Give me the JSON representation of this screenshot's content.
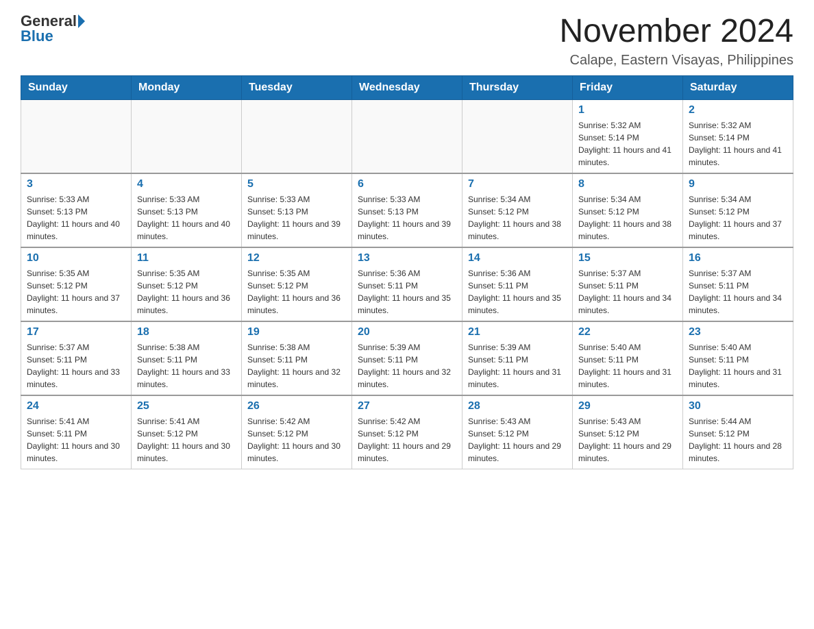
{
  "header": {
    "logo_general": "General",
    "logo_blue": "Blue",
    "month_title": "November 2024",
    "location": "Calape, Eastern Visayas, Philippines"
  },
  "days_of_week": [
    "Sunday",
    "Monday",
    "Tuesday",
    "Wednesday",
    "Thursday",
    "Friday",
    "Saturday"
  ],
  "weeks": [
    [
      {
        "day": "",
        "info": ""
      },
      {
        "day": "",
        "info": ""
      },
      {
        "day": "",
        "info": ""
      },
      {
        "day": "",
        "info": ""
      },
      {
        "day": "",
        "info": ""
      },
      {
        "day": "1",
        "info": "Sunrise: 5:32 AM\nSunset: 5:14 PM\nDaylight: 11 hours and 41 minutes."
      },
      {
        "day": "2",
        "info": "Sunrise: 5:32 AM\nSunset: 5:14 PM\nDaylight: 11 hours and 41 minutes."
      }
    ],
    [
      {
        "day": "3",
        "info": "Sunrise: 5:33 AM\nSunset: 5:13 PM\nDaylight: 11 hours and 40 minutes."
      },
      {
        "day": "4",
        "info": "Sunrise: 5:33 AM\nSunset: 5:13 PM\nDaylight: 11 hours and 40 minutes."
      },
      {
        "day": "5",
        "info": "Sunrise: 5:33 AM\nSunset: 5:13 PM\nDaylight: 11 hours and 39 minutes."
      },
      {
        "day": "6",
        "info": "Sunrise: 5:33 AM\nSunset: 5:13 PM\nDaylight: 11 hours and 39 minutes."
      },
      {
        "day": "7",
        "info": "Sunrise: 5:34 AM\nSunset: 5:12 PM\nDaylight: 11 hours and 38 minutes."
      },
      {
        "day": "8",
        "info": "Sunrise: 5:34 AM\nSunset: 5:12 PM\nDaylight: 11 hours and 38 minutes."
      },
      {
        "day": "9",
        "info": "Sunrise: 5:34 AM\nSunset: 5:12 PM\nDaylight: 11 hours and 37 minutes."
      }
    ],
    [
      {
        "day": "10",
        "info": "Sunrise: 5:35 AM\nSunset: 5:12 PM\nDaylight: 11 hours and 37 minutes."
      },
      {
        "day": "11",
        "info": "Sunrise: 5:35 AM\nSunset: 5:12 PM\nDaylight: 11 hours and 36 minutes."
      },
      {
        "day": "12",
        "info": "Sunrise: 5:35 AM\nSunset: 5:12 PM\nDaylight: 11 hours and 36 minutes."
      },
      {
        "day": "13",
        "info": "Sunrise: 5:36 AM\nSunset: 5:11 PM\nDaylight: 11 hours and 35 minutes."
      },
      {
        "day": "14",
        "info": "Sunrise: 5:36 AM\nSunset: 5:11 PM\nDaylight: 11 hours and 35 minutes."
      },
      {
        "day": "15",
        "info": "Sunrise: 5:37 AM\nSunset: 5:11 PM\nDaylight: 11 hours and 34 minutes."
      },
      {
        "day": "16",
        "info": "Sunrise: 5:37 AM\nSunset: 5:11 PM\nDaylight: 11 hours and 34 minutes."
      }
    ],
    [
      {
        "day": "17",
        "info": "Sunrise: 5:37 AM\nSunset: 5:11 PM\nDaylight: 11 hours and 33 minutes."
      },
      {
        "day": "18",
        "info": "Sunrise: 5:38 AM\nSunset: 5:11 PM\nDaylight: 11 hours and 33 minutes."
      },
      {
        "day": "19",
        "info": "Sunrise: 5:38 AM\nSunset: 5:11 PM\nDaylight: 11 hours and 32 minutes."
      },
      {
        "day": "20",
        "info": "Sunrise: 5:39 AM\nSunset: 5:11 PM\nDaylight: 11 hours and 32 minutes."
      },
      {
        "day": "21",
        "info": "Sunrise: 5:39 AM\nSunset: 5:11 PM\nDaylight: 11 hours and 31 minutes."
      },
      {
        "day": "22",
        "info": "Sunrise: 5:40 AM\nSunset: 5:11 PM\nDaylight: 11 hours and 31 minutes."
      },
      {
        "day": "23",
        "info": "Sunrise: 5:40 AM\nSunset: 5:11 PM\nDaylight: 11 hours and 31 minutes."
      }
    ],
    [
      {
        "day": "24",
        "info": "Sunrise: 5:41 AM\nSunset: 5:11 PM\nDaylight: 11 hours and 30 minutes."
      },
      {
        "day": "25",
        "info": "Sunrise: 5:41 AM\nSunset: 5:12 PM\nDaylight: 11 hours and 30 minutes."
      },
      {
        "day": "26",
        "info": "Sunrise: 5:42 AM\nSunset: 5:12 PM\nDaylight: 11 hours and 30 minutes."
      },
      {
        "day": "27",
        "info": "Sunrise: 5:42 AM\nSunset: 5:12 PM\nDaylight: 11 hours and 29 minutes."
      },
      {
        "day": "28",
        "info": "Sunrise: 5:43 AM\nSunset: 5:12 PM\nDaylight: 11 hours and 29 minutes."
      },
      {
        "day": "29",
        "info": "Sunrise: 5:43 AM\nSunset: 5:12 PM\nDaylight: 11 hours and 29 minutes."
      },
      {
        "day": "30",
        "info": "Sunrise: 5:44 AM\nSunset: 5:12 PM\nDaylight: 11 hours and 28 minutes."
      }
    ]
  ]
}
